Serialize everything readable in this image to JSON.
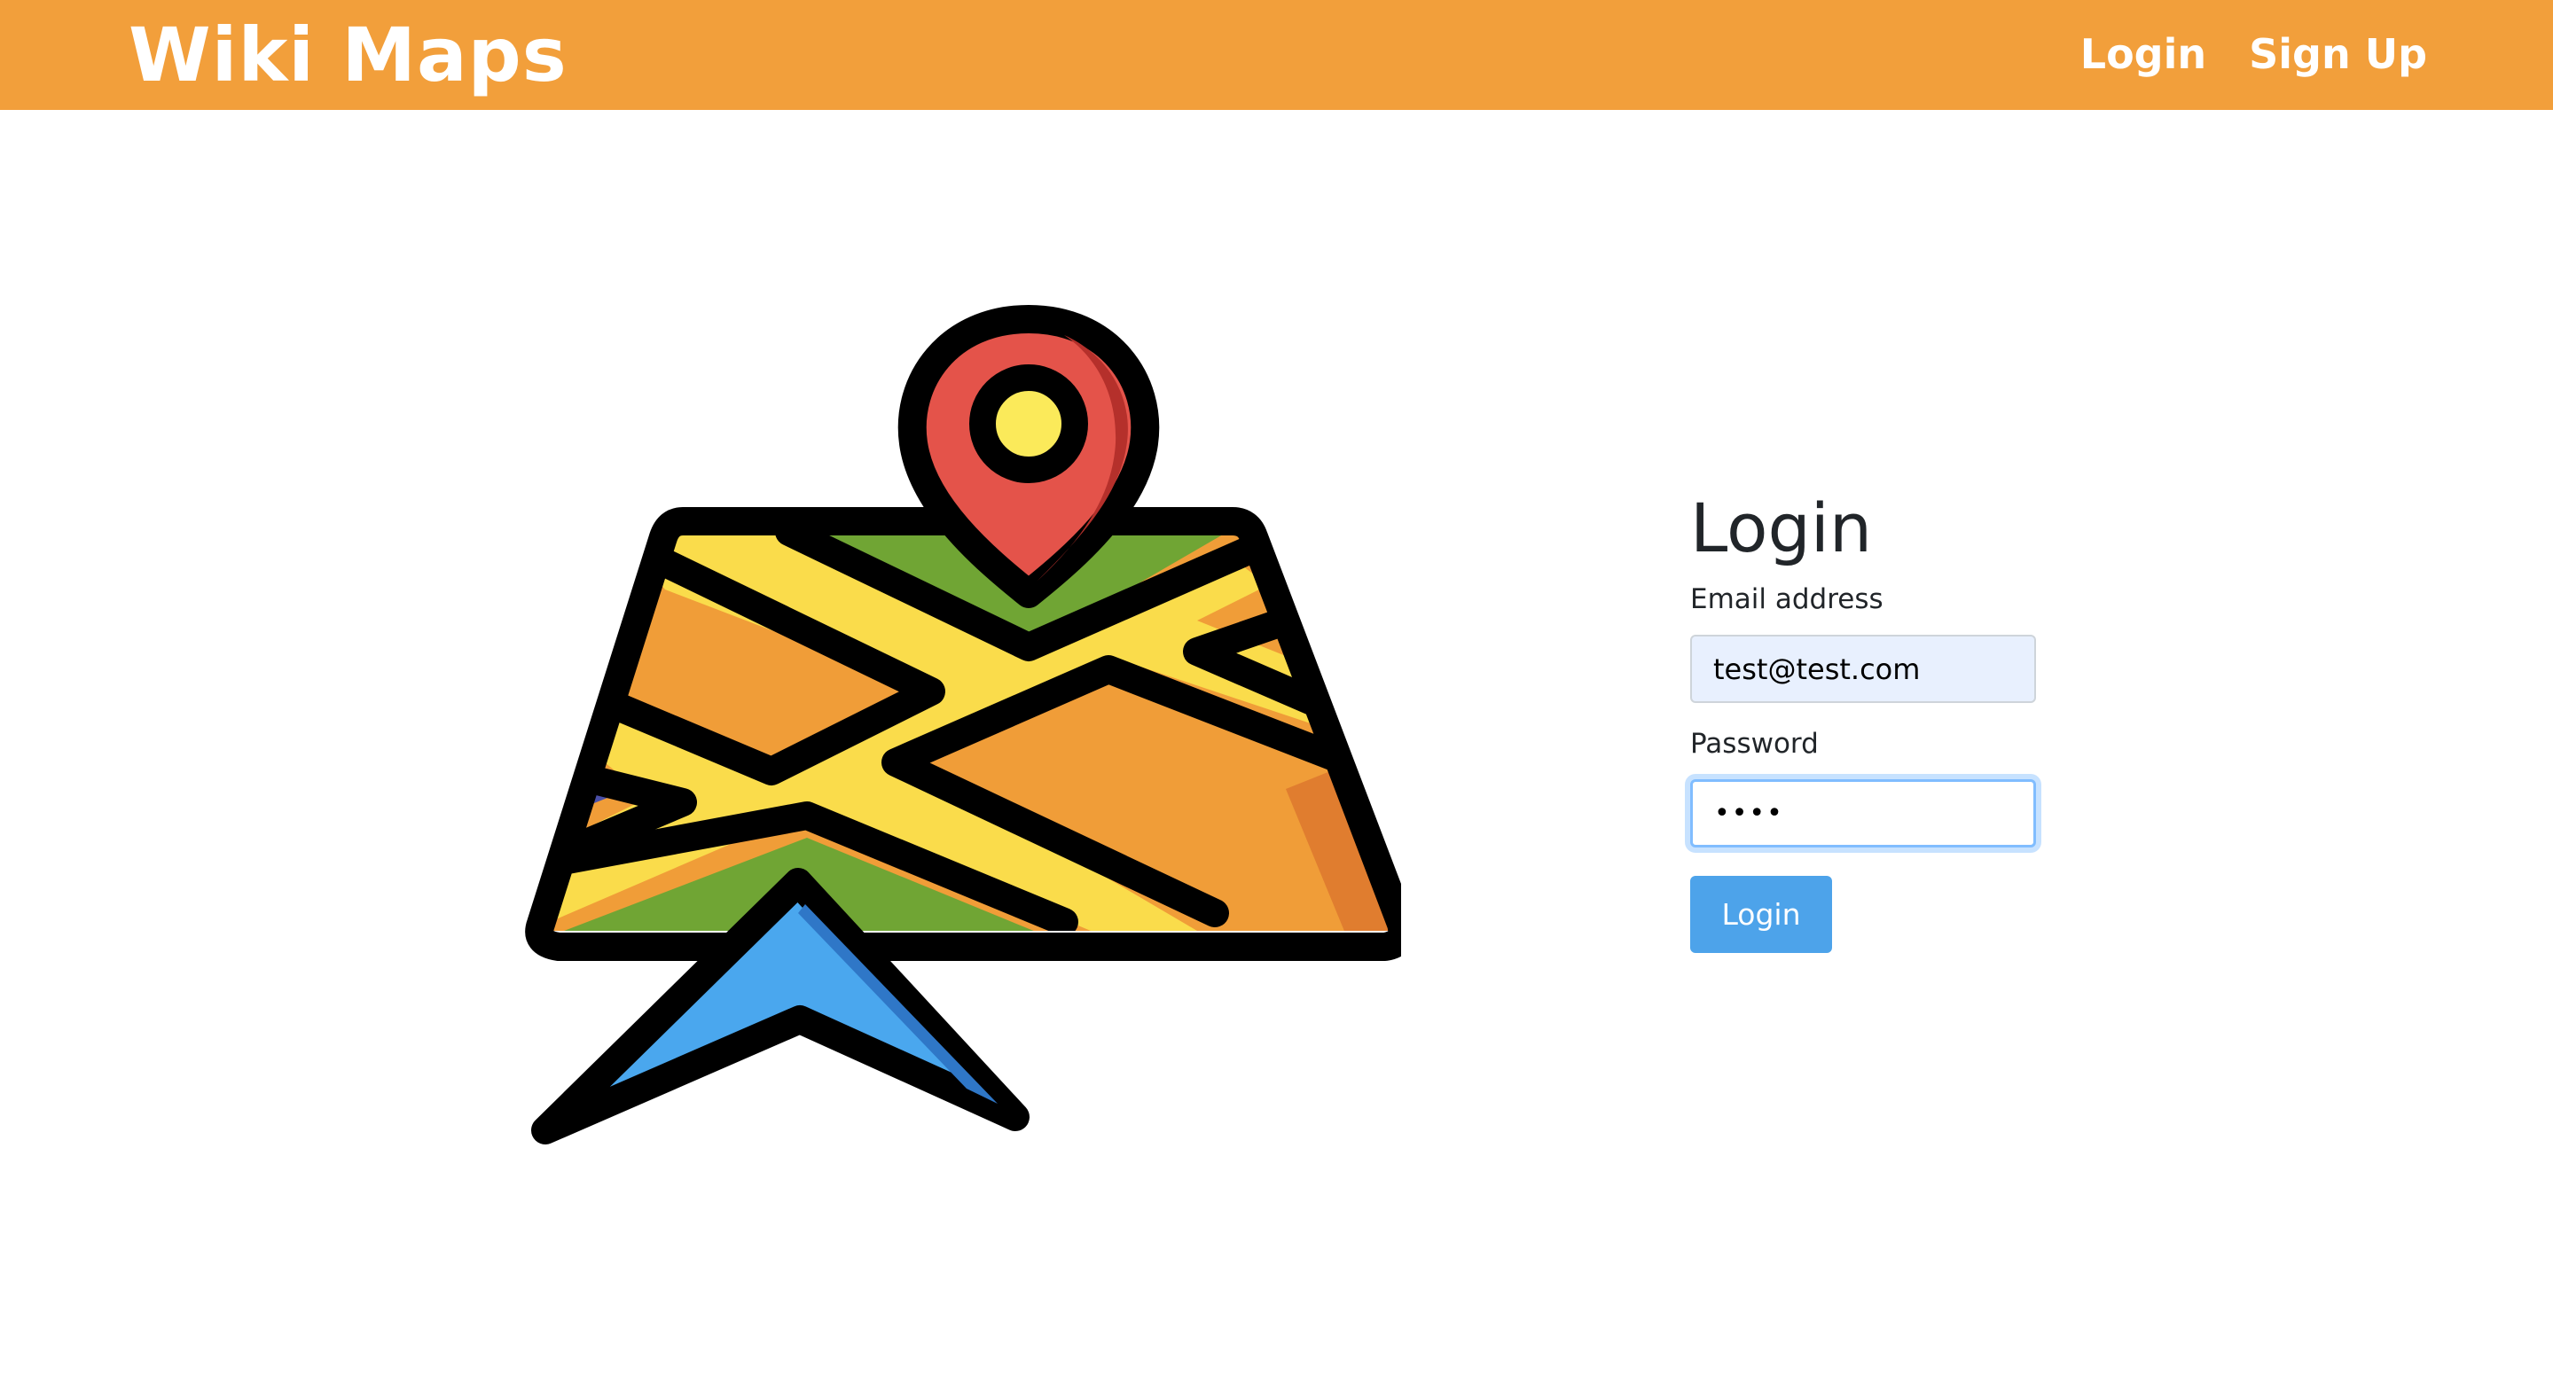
{
  "navbar": {
    "brand": "Wiki Maps",
    "links": [
      {
        "label": "Login"
      },
      {
        "label": "Sign Up"
      }
    ],
    "background_color": "#f29f3b"
  },
  "hero": {
    "icon": "map-with-location-pin-icon"
  },
  "login_form": {
    "title": "Login",
    "email": {
      "label": "Email address",
      "value": "test@test.com"
    },
    "password": {
      "label": "Password",
      "value": "••••"
    },
    "submit_label": "Login",
    "submit_color": "#4da3ea"
  }
}
